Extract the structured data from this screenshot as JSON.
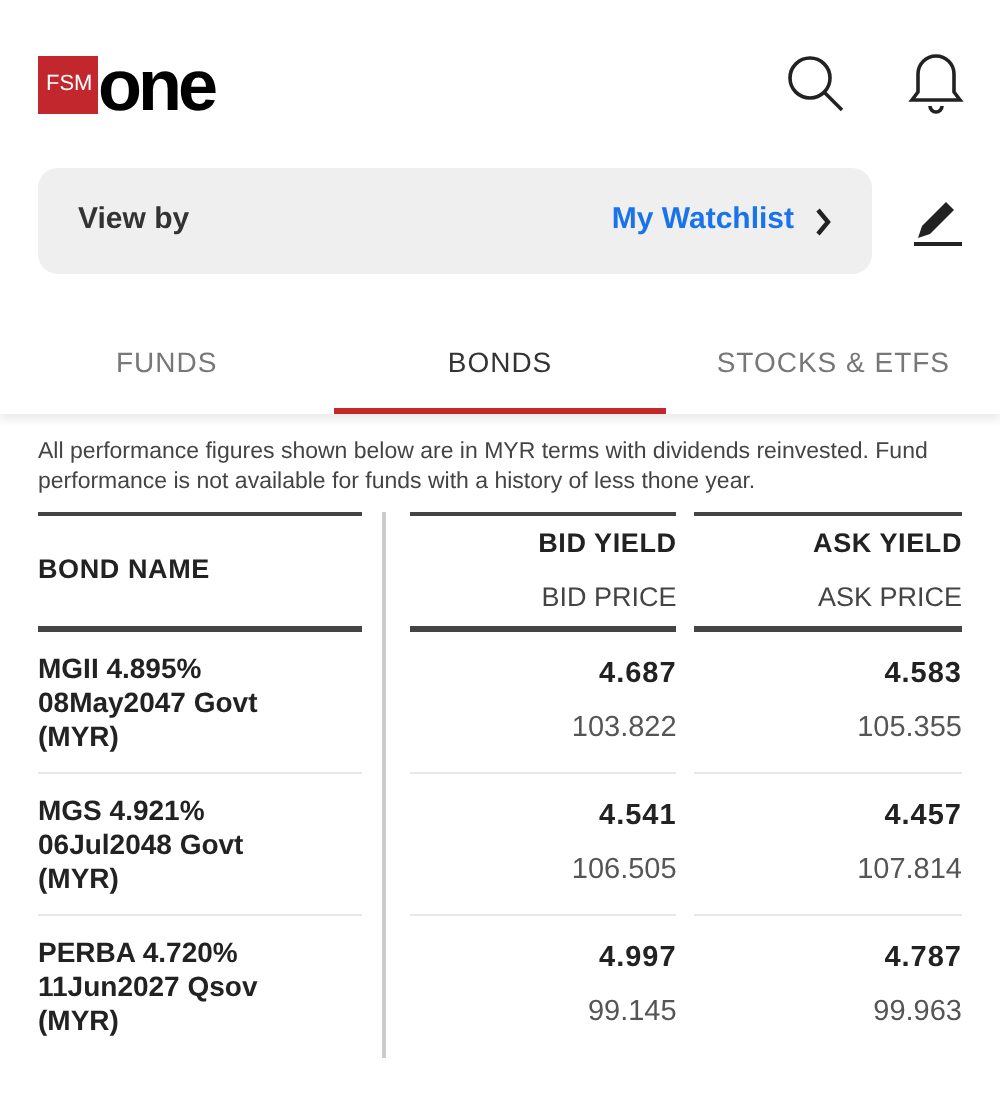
{
  "logo": {
    "badge": "FSM",
    "wordmark": "one"
  },
  "view_by": {
    "label": "View by",
    "value": "My Watchlist"
  },
  "tabs": [
    {
      "label": "FUNDS",
      "selected": false
    },
    {
      "label": "BONDS",
      "selected": true
    },
    {
      "label": "STOCKS & ETFS",
      "selected": false
    }
  ],
  "disclaimer": "All performance figures shown below are in MYR terms with dividends reinvested. Fund performance is not available for funds with a history of less thone year.",
  "table": {
    "columns": [
      {
        "title": "BOND NAME"
      },
      {
        "title": "BID YIELD",
        "subtitle": "BID PRICE"
      },
      {
        "title": "ASK YIELD",
        "subtitle": "ASK PRICE"
      }
    ],
    "rows": [
      {
        "name": "MGII 4.895% 08May2047 Govt (MYR)",
        "bid_yield": "4.687",
        "bid_price": "103.822",
        "ask_yield": "4.583",
        "ask_price": "105.355"
      },
      {
        "name": "MGS 4.921% 06Jul2048 Govt (MYR)",
        "bid_yield": "4.541",
        "bid_price": "106.505",
        "ask_yield": "4.457",
        "ask_price": "107.814"
      },
      {
        "name": "PERBA 4.720% 11Jun2027 Qsov (MYR)",
        "bid_yield": "4.997",
        "bid_price": "99.145",
        "ask_yield": "4.787",
        "ask_price": "99.963"
      }
    ]
  }
}
